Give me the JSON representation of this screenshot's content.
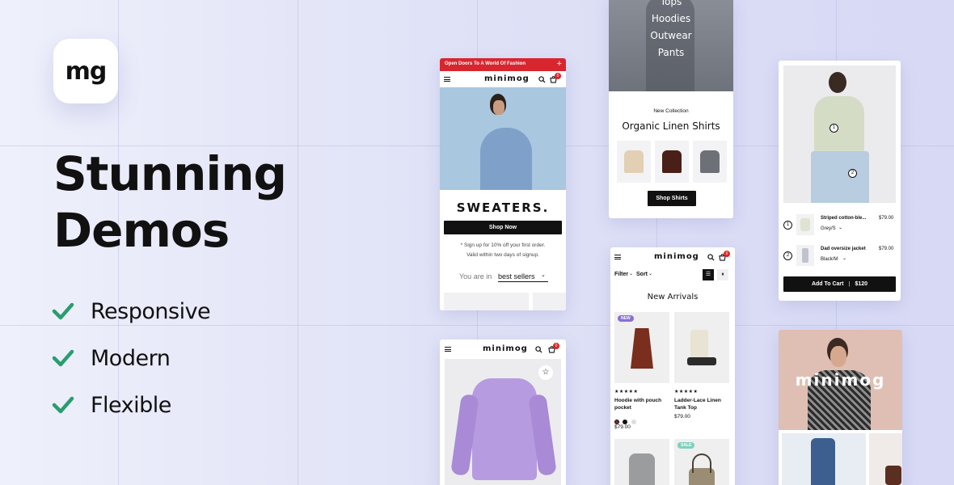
{
  "brand": {
    "logo_text": "mg",
    "name": "minimog"
  },
  "hero": {
    "headline": "Stunning Demos",
    "features": [
      "Responsive",
      "Modern",
      "Flexible"
    ],
    "check_color": "#2a9d6e"
  },
  "phone_sweaters": {
    "announcement": "Open Doors To A World Of Fashion",
    "announcement_color": "#d8262f",
    "title": "SWEATERS.",
    "shop_button": "Shop Now",
    "promo_line1": "* Sign up for 10% off your first order.",
    "promo_line2": "Valid within two days of signup.",
    "you_are_in": "You are in",
    "you_are_in_value": "best sellers",
    "cart_count": "0",
    "icons": [
      "menu-icon",
      "search-icon",
      "cart-icon",
      "chevron-down-icon"
    ]
  },
  "linen_card": {
    "menu_items": [
      "Tops",
      "Hoodies",
      "Outwear",
      "Pants"
    ],
    "eyebrow": "New Collection",
    "title": "Organic Linen Shirts",
    "button": "Shop Shirts"
  },
  "new_arrivals": {
    "filter_label": "Filter",
    "sort_label": "Sort",
    "title": "New Arrivals",
    "cart_count": "0",
    "products": [
      {
        "badge": "NEW",
        "name": "Hoodie with pouch pocket",
        "rating": "★★★★★",
        "price": "$79.00"
      },
      {
        "badge": "",
        "name": "Ladder-Lace Linen Tank Top",
        "rating": "★★★★★",
        "price": "$79.00"
      },
      {
        "badge": "",
        "name": "",
        "rating": "",
        "price": ""
      },
      {
        "badge": "SALE",
        "name": "",
        "rating": "",
        "price": ""
      }
    ],
    "badge_colors": {
      "new": "#8a6fd1",
      "sale": "#7fd0bd"
    }
  },
  "shop_look": {
    "items": [
      {
        "marker": "1",
        "name": "Striped cotton-ble...",
        "variant": "Grey/S",
        "price": "$79.00"
      },
      {
        "marker": "2",
        "name": "Dad oversize jacket",
        "variant": "Black/M",
        "price": "$79.00"
      }
    ],
    "add_to_cart": "Add To Cart",
    "total": "$120"
  },
  "hoodie_phone": {
    "cart_count": "0"
  },
  "brand_card": {
    "wordmark": "minimog"
  }
}
